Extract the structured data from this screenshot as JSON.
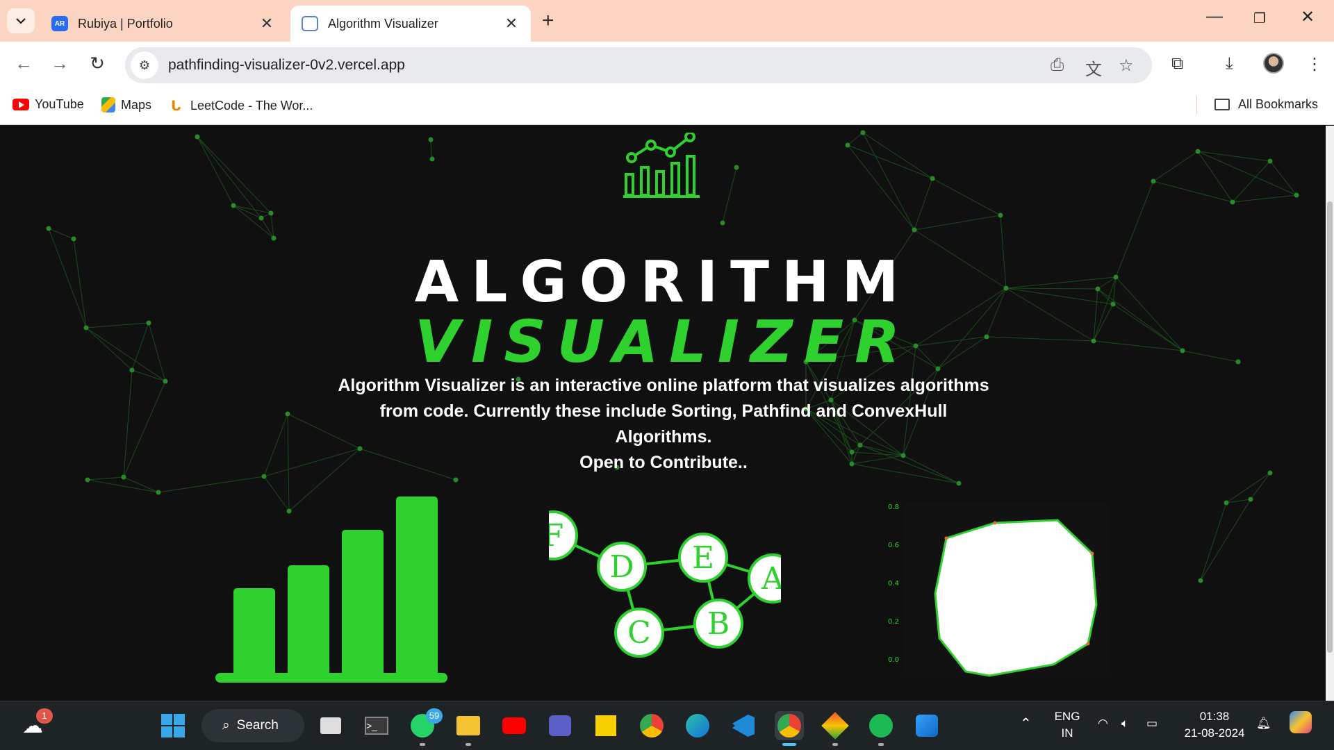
{
  "tabs": [
    {
      "icon": "AR",
      "title": "Rubiya | Portfolio",
      "active": false
    },
    {
      "icon": "code-doc",
      "title": "Algorithm Visualizer",
      "active": true
    }
  ],
  "address_bar": {
    "url": "pathfinding-visualizer-0v2.vercel.app"
  },
  "bookmarks": [
    {
      "label": "YouTube"
    },
    {
      "label": "Maps"
    },
    {
      "label": "LeetCode - The Wor..."
    }
  ],
  "all_bookmarks_label": "All Bookmarks",
  "hero": {
    "title_line1": "ALGORITHM",
    "title_line2": "VISUALIZER",
    "description_line1": "Algorithm Visualizer is an interactive online platform that visualizes algorithms",
    "description_line2": "from code. Currently these include Sorting, Pathfind and ConvexHull Algorithms.",
    "description_line3": "Open to Contribute.."
  },
  "colors": {
    "accent_green": "#2ed12e",
    "background": "#101010"
  },
  "sorting_preview": {
    "bar_heights": [
      0.42,
      0.53,
      0.7,
      0.86
    ]
  },
  "graph_preview": {
    "nodes": [
      "F",
      "D",
      "E",
      "A",
      "B",
      "C"
    ]
  },
  "convex_hull_preview": {
    "y_ticks": [
      "0.8",
      "0.6",
      "0.4",
      "0.2",
      "0.0"
    ]
  },
  "taskbar": {
    "search_label": "Search",
    "weather_badge": "1",
    "whatsapp_badge": "59",
    "language_line1": "ENG",
    "language_line2": "IN",
    "time": "01:38",
    "date": "21-08-2024"
  }
}
